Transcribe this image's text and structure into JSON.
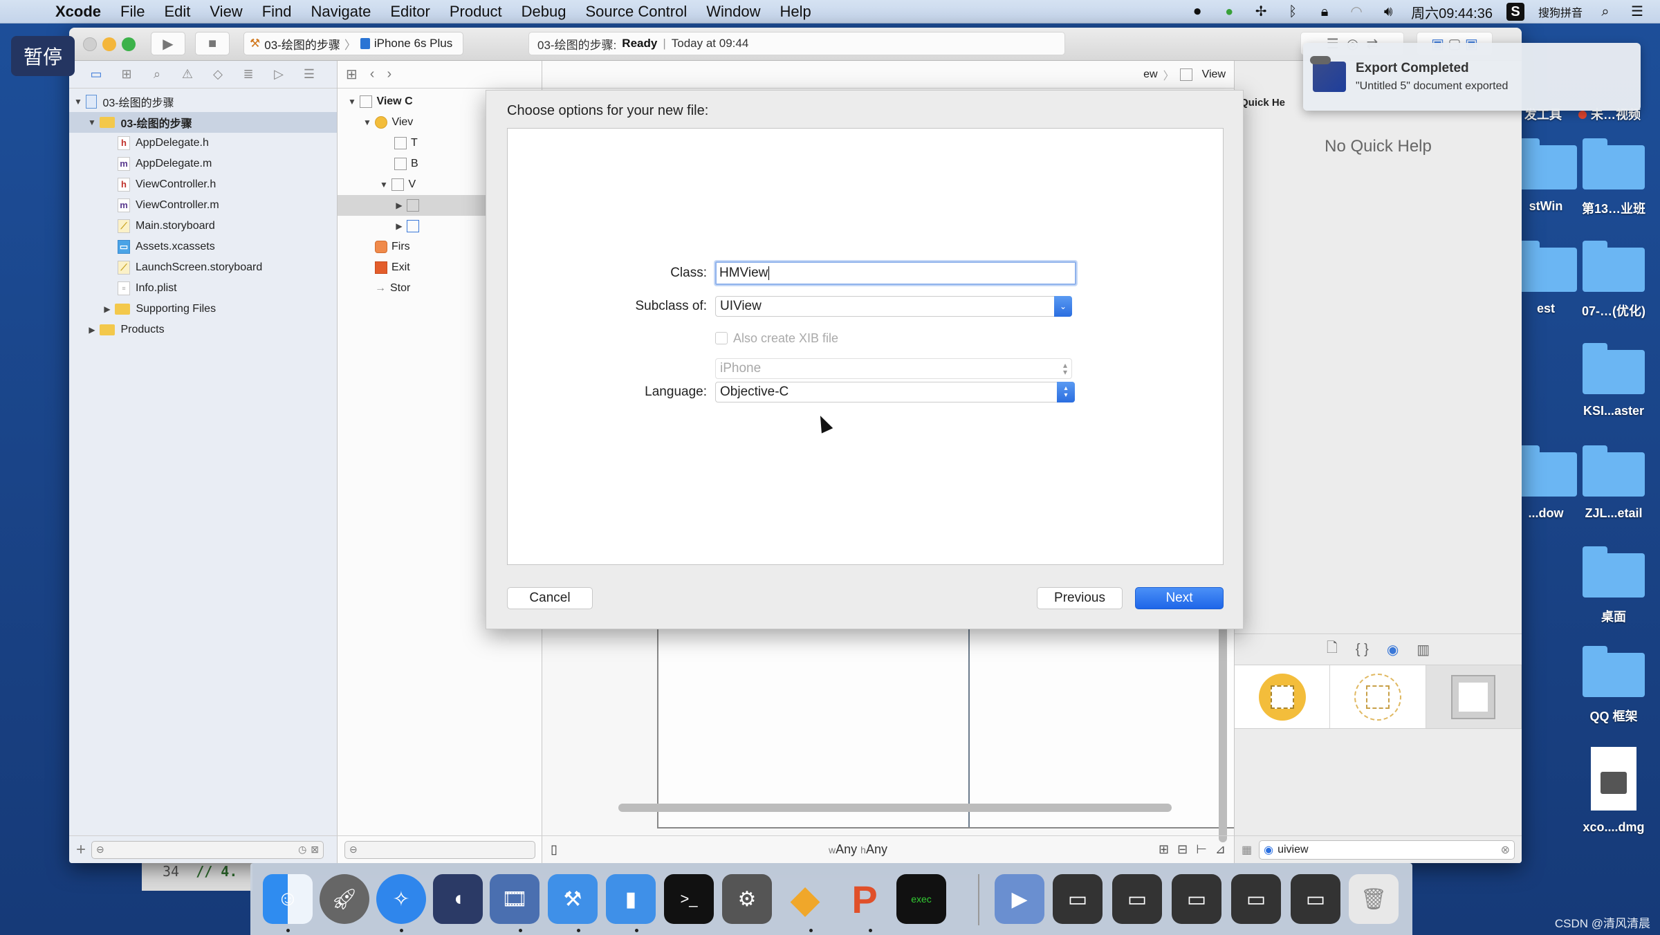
{
  "menubar": {
    "app": "Xcode",
    "items": [
      "File",
      "Edit",
      "View",
      "Find",
      "Navigate",
      "Editor",
      "Product",
      "Debug",
      "Source Control",
      "Window",
      "Help"
    ],
    "clock": "周六09:44:36",
    "input_method": "搜狗拼音"
  },
  "overlay": {
    "pause_label": "暂停"
  },
  "toolbar": {
    "scheme_project": "03-绘图的步骤",
    "scheme_device": "iPhone 6s Plus",
    "status_project": "03-绘图的步骤:",
    "status_state": "Ready",
    "status_separator": "|",
    "status_time": "Today at 09:44"
  },
  "navigator": {
    "project": "03-绘图的步骤",
    "group": "03-绘图的步骤",
    "files": [
      {
        "name": "AppDelegate.h",
        "type": "h",
        "glyph": "h"
      },
      {
        "name": "AppDelegate.m",
        "type": "m",
        "glyph": "m"
      },
      {
        "name": "ViewController.h",
        "type": "h",
        "glyph": "h"
      },
      {
        "name": "ViewController.m",
        "type": "m",
        "glyph": "m"
      },
      {
        "name": "Main.storyboard",
        "type": "sb",
        "glyph": "⟋"
      },
      {
        "name": "Assets.xcassets",
        "type": "assets",
        "glyph": "▭"
      },
      {
        "name": "LaunchScreen.storyboard",
        "type": "sb",
        "glyph": "⟋"
      },
      {
        "name": "Info.plist",
        "type": "plist",
        "glyph": "≡"
      }
    ],
    "supporting_files": "Supporting Files",
    "products": "Products"
  },
  "outline": {
    "rows": [
      "View C",
      "Viev",
      "T",
      "B",
      "V",
      "",
      "",
      "Firs",
      "Exit",
      "Stor"
    ]
  },
  "canvas": {
    "jump_prev": "ew",
    "jump_current": "View",
    "size_w_prefix": "w",
    "size_w": "Any",
    "size_h_prefix": "h",
    "size_h": "Any"
  },
  "utilities": {
    "quick_help_title": "Quick He",
    "no_quick_help": "No Quick Help",
    "library_search_value": "uiview"
  },
  "dialog": {
    "title": "Choose options for your new file:",
    "class_label": "Class:",
    "class_value": "HMView",
    "subclass_label": "Subclass of:",
    "subclass_value": "UIView",
    "xib_label": "Also create XIB file",
    "xib_checked": false,
    "device_value": "iPhone",
    "language_label": "Language:",
    "language_value": "Objective-C",
    "cancel": "Cancel",
    "previous": "Previous",
    "next": "Next"
  },
  "notification": {
    "title": "Export Completed",
    "body": "\"Untitled 5\" document exported"
  },
  "desktop": {
    "top_labels": [
      "发工具",
      "未…视频"
    ],
    "icons": [
      {
        "label": "stWin",
        "kind": "folder"
      },
      {
        "label": "第13…业班",
        "kind": "folder"
      },
      {
        "label": "est",
        "kind": "folder"
      },
      {
        "label": "07-…(优化)",
        "kind": "folder"
      },
      {
        "label": "KSI...aster",
        "kind": "folder"
      },
      {
        "label": "...dow",
        "kind": "folder"
      },
      {
        "label": "ZJL...etail",
        "kind": "folder"
      },
      {
        "label": "桌面",
        "kind": "folder"
      },
      {
        "label": "QQ 框架",
        "kind": "folder"
      },
      {
        "label": "xco....dmg",
        "kind": "dmg"
      }
    ]
  },
  "background_code": {
    "line_number": "34",
    "code": "// 4."
  },
  "dock": {
    "apps": [
      "Finder",
      "Launchpad",
      "Safari",
      "Mouse",
      "Screen Recorder",
      "Xcode",
      "Simulator",
      "Terminal",
      "System Preferences",
      "Sketch",
      "PowerPoint",
      "Console",
      "Media Player",
      "Window 1",
      "Window 2",
      "Window 3",
      "Window 4",
      "Window 5",
      "Trash"
    ]
  },
  "watermark": "CSDN @清风清晨",
  "colors": {
    "accent": "#1e66e8",
    "desktop": "#1a4488",
    "selection_bar": "#4e7de0"
  }
}
